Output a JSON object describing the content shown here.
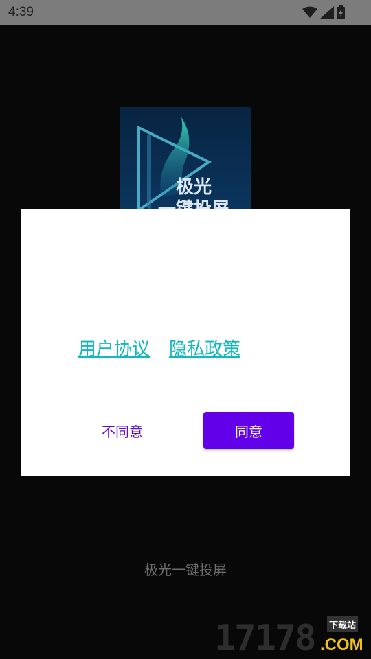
{
  "status_bar": {
    "time": "4:39",
    "icons": [
      "wifi-icon",
      "signal-icon",
      "battery-icon"
    ]
  },
  "splash": {
    "logo_line1": "极光",
    "logo_line2": "一键投屏",
    "app_name": "极光一键投屏"
  },
  "dialog": {
    "link_user_agreement": "用户协议",
    "link_privacy_policy": "隐私政策",
    "disagree_label": "不同意",
    "agree_label": "同意"
  },
  "watermark": {
    "digits": "17178",
    "suffix": ".COM",
    "tag": "下载站"
  },
  "colors": {
    "accent": "#6200ea",
    "link": "#12b8bf",
    "status_bar": "#7c7c7c",
    "background": "#080808"
  }
}
